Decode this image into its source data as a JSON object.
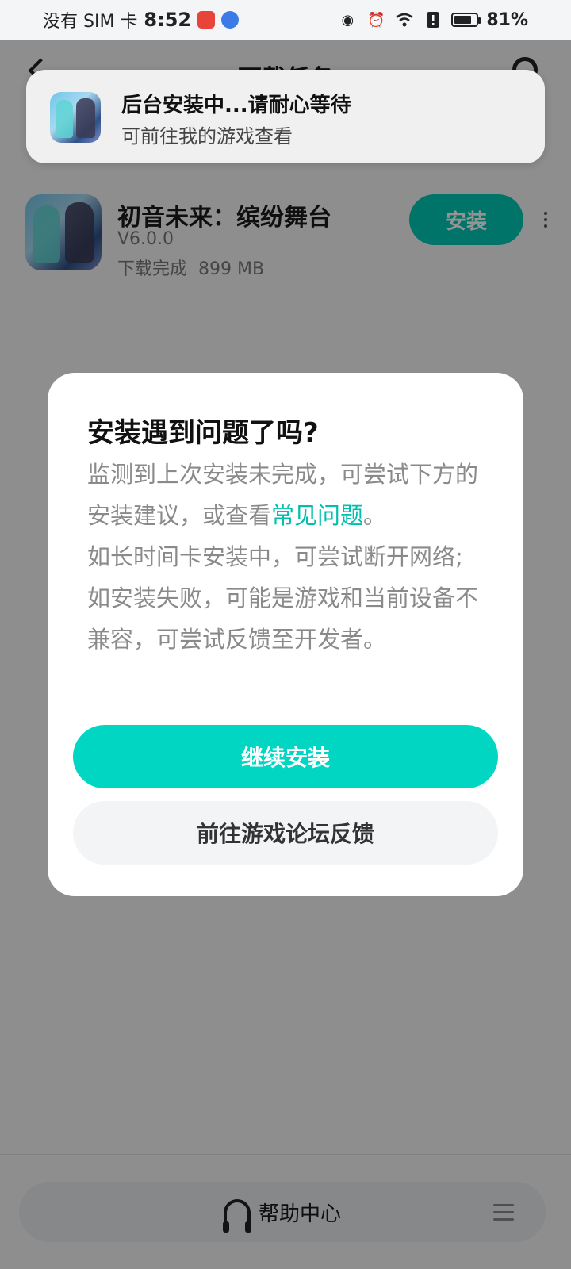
{
  "status_bar": {
    "carrier": "没有 SIM 卡",
    "time": "8:52",
    "battery_text": "81%",
    "battery_level": 0.81
  },
  "header": {
    "title": "下载任务"
  },
  "toast": {
    "title": "后台安装中...请耐心等待",
    "subtitle": "可前往我的游戏查看"
  },
  "game": {
    "name": "初音未来：缤纷舞台",
    "version": "V6.0.0",
    "status": "下载完成",
    "size": "899 MB",
    "action_label": "安装"
  },
  "dialog": {
    "title": "安装遇到问题了吗?",
    "line1_before_link": "监测到上次安装未完成，可尝试下方的安装建议，或查看",
    "link_text": "常见问题",
    "line1_after_link": "。",
    "line2": "如长时间卡安装中，可尝试断开网络;",
    "line3": "如安装失败，可能是游戏和当前设备不兼容，可尝试反馈至开发者。",
    "primary_button": "继续安装",
    "secondary_button": "前往游戏论坛反馈"
  },
  "help": {
    "label": "帮助中心"
  },
  "colors": {
    "accent": "#00d6c2",
    "link": "#00bfae"
  }
}
